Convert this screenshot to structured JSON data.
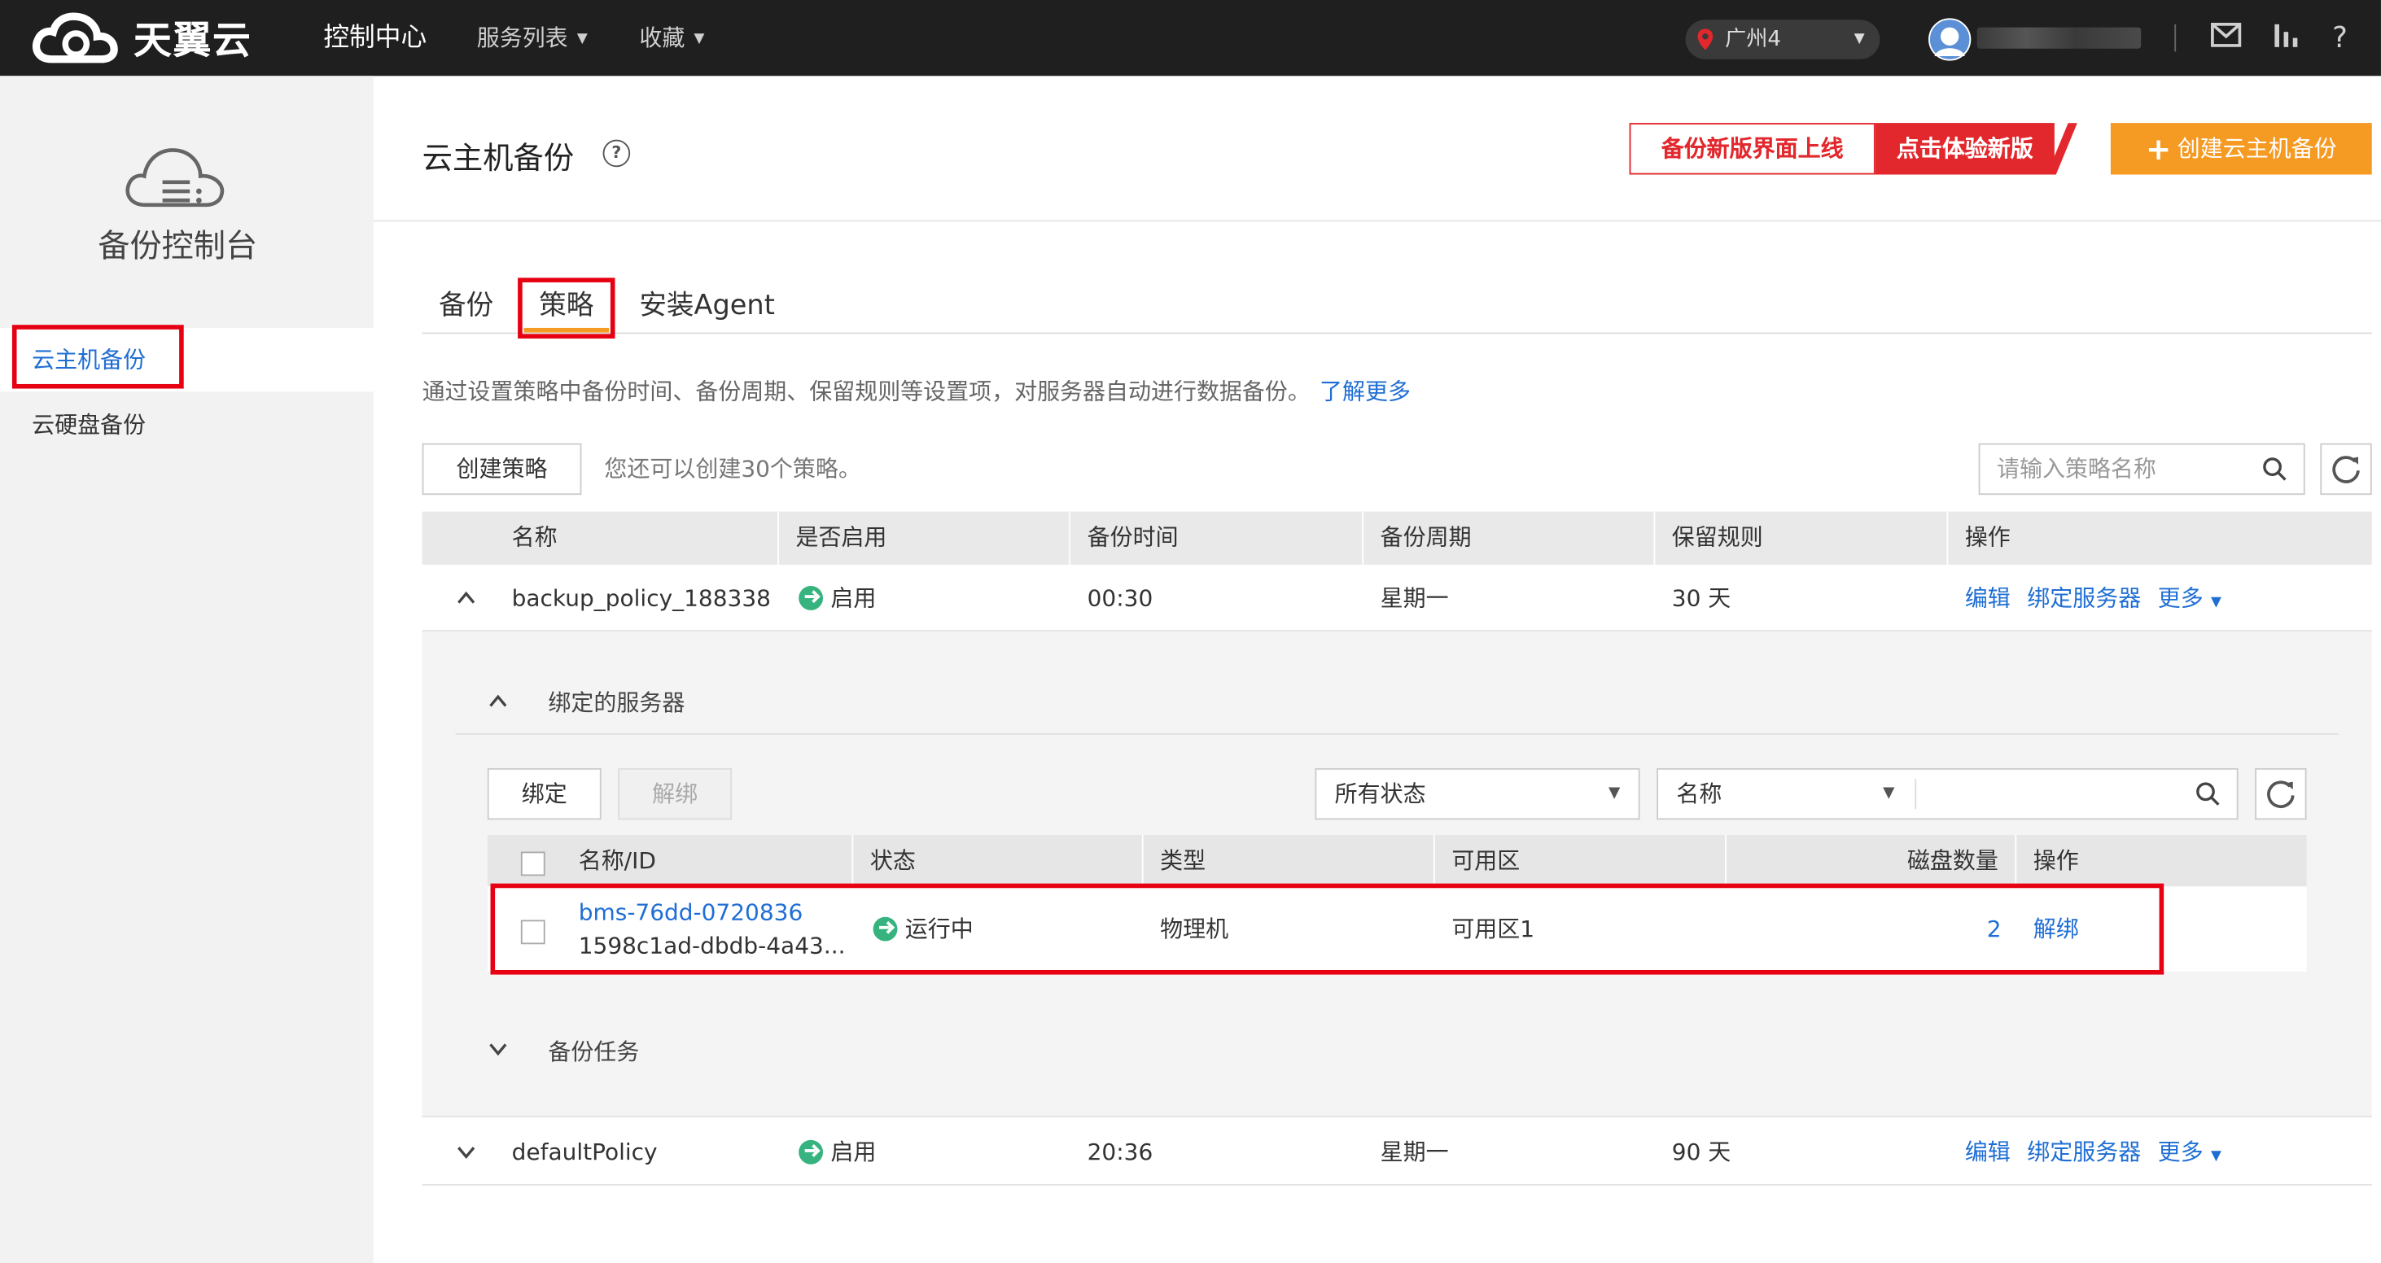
{
  "topbar": {
    "brand": "天翼云",
    "nav": [
      {
        "label": "控制中心"
      },
      {
        "label": "服务列表"
      },
      {
        "label": "收藏"
      }
    ],
    "region": "广州4",
    "icons": [
      "mail-icon",
      "chart-icon",
      "help-icon"
    ]
  },
  "sidebar": {
    "title": "备份控制台",
    "items": [
      {
        "label": "云主机备份",
        "active": true
      },
      {
        "label": "云硬盘备份",
        "active": false
      }
    ]
  },
  "header": {
    "title": "云主机备份",
    "banner_left": "备份新版界面上线",
    "banner_right": "点击体验新版",
    "create_button": "创建云主机备份"
  },
  "tabs": [
    {
      "label": "备份"
    },
    {
      "label": "策略",
      "active": true
    },
    {
      "label": "安装Agent"
    }
  ],
  "description": {
    "text": "通过设置策略中备份时间、备份周期、保留规则等设置项，对服务器自动进行数据备份。",
    "link": "了解更多"
  },
  "toolbar": {
    "create_policy": "创建策略",
    "hint": "您还可以创建30个策略。",
    "search_placeholder": "请输入策略名称"
  },
  "policy_table": {
    "columns": [
      "名称",
      "是否启用",
      "备份时间",
      "备份周期",
      "保留规则",
      "操作"
    ],
    "rows": [
      {
        "name": "backup_policy_188338",
        "enabled": "启用",
        "time": "00:30",
        "cycle": "星期一",
        "retention": "30 天",
        "actions": [
          "编辑",
          "绑定服务器",
          "更多"
        ]
      },
      {
        "name": "defaultPolicy",
        "enabled": "启用",
        "time": "20:36",
        "cycle": "星期一",
        "retention": "90 天",
        "actions": [
          "编辑",
          "绑定服务器",
          "更多"
        ]
      }
    ]
  },
  "bound_servers": {
    "section_title": "绑定的服务器",
    "bind_button": "绑定",
    "unbind_button": "解绑",
    "status_filter": "所有状态",
    "field_filter": "名称",
    "columns": [
      "名称/ID",
      "状态",
      "类型",
      "可用区",
      "磁盘数量",
      "操作"
    ],
    "rows": [
      {
        "name": "bms-76dd-0720836",
        "id": "1598c1ad-dbdb-4a43...",
        "status": "运行中",
        "type": "物理机",
        "zone": "可用区1",
        "disks": "2",
        "action": "解绑"
      }
    ]
  },
  "backup_tasks": {
    "section_title": "备份任务"
  },
  "colors": {
    "accent": "#1f6ed4",
    "orange": "#f59a23",
    "highlight_red": "#e60012",
    "status_green": "#36b37e"
  }
}
